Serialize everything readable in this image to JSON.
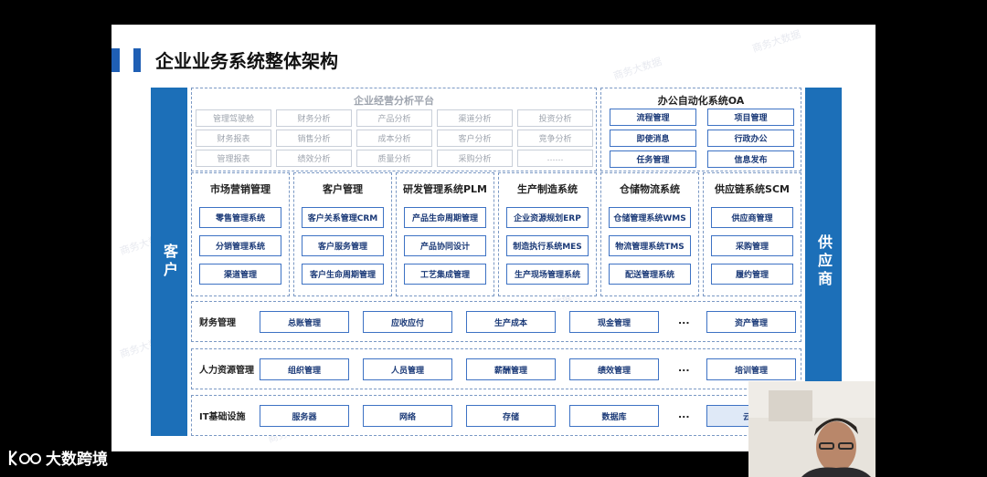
{
  "title": "企业业务系统整体架构",
  "watermark": "商务大数据",
  "left_label": "客户",
  "right_label": "供应商",
  "analytics": {
    "title": "企业经营分析平台",
    "items": [
      "管理驾驶舱",
      "财务分析",
      "产品分析",
      "渠道分析",
      "投资分析",
      "财务报表",
      "销售分析",
      "成本分析",
      "客户分析",
      "竞争分析",
      "管理报表",
      "绩效分析",
      "质量分析",
      "采购分析",
      "……"
    ]
  },
  "oa": {
    "title": "办公自动化系统OA",
    "items": [
      "流程管理",
      "项目管理",
      "即使消息",
      "行政办公",
      "任务管理",
      "信息发布"
    ]
  },
  "columns": [
    {
      "title": "市场营销管理",
      "items": [
        "零售管理系统",
        "分销管理系统",
        "渠道管理"
      ]
    },
    {
      "title": "客户管理",
      "items": [
        "客户关系管理CRM",
        "客户服务管理",
        "客户生命周期管理"
      ]
    },
    {
      "title": "研发管理系统PLM",
      "items": [
        "产品生命周期管理",
        "产品协同设计",
        "工艺集成管理"
      ]
    },
    {
      "title": "生产制造系统",
      "items": [
        "企业资源规划ERP",
        "制造执行系统MES",
        "生产现场管理系统"
      ]
    },
    {
      "title": "仓储物流系统",
      "items": [
        "仓储管理系统WMS",
        "物流管理系统TMS",
        "配送管理系统"
      ]
    },
    {
      "title": "供应链系统SCM",
      "items": [
        "供应商管理",
        "采购管理",
        "履约管理"
      ]
    }
  ],
  "rows": [
    {
      "label": "财务管理",
      "items": [
        "总账管理",
        "应收应付",
        "生产成本",
        "现金管理"
      ],
      "dots": "...",
      "last": "资产管理"
    },
    {
      "label": "人力资源管理",
      "items": [
        "组织管理",
        "人员管理",
        "薪酬管理",
        "绩效管理"
      ],
      "dots": "...",
      "last": "培训管理"
    },
    {
      "label": "IT基础设施",
      "items": [
        "服务器",
        "网络",
        "存储",
        "数据库"
      ],
      "dots": "...",
      "last": "云计"
    }
  ],
  "brand": "大数跨境",
  "colors": {
    "primary": "#1c6fb8",
    "dark_blue": "#1f5fb4",
    "button_border": "#3d72c4",
    "button_text": "#1b3a78"
  }
}
